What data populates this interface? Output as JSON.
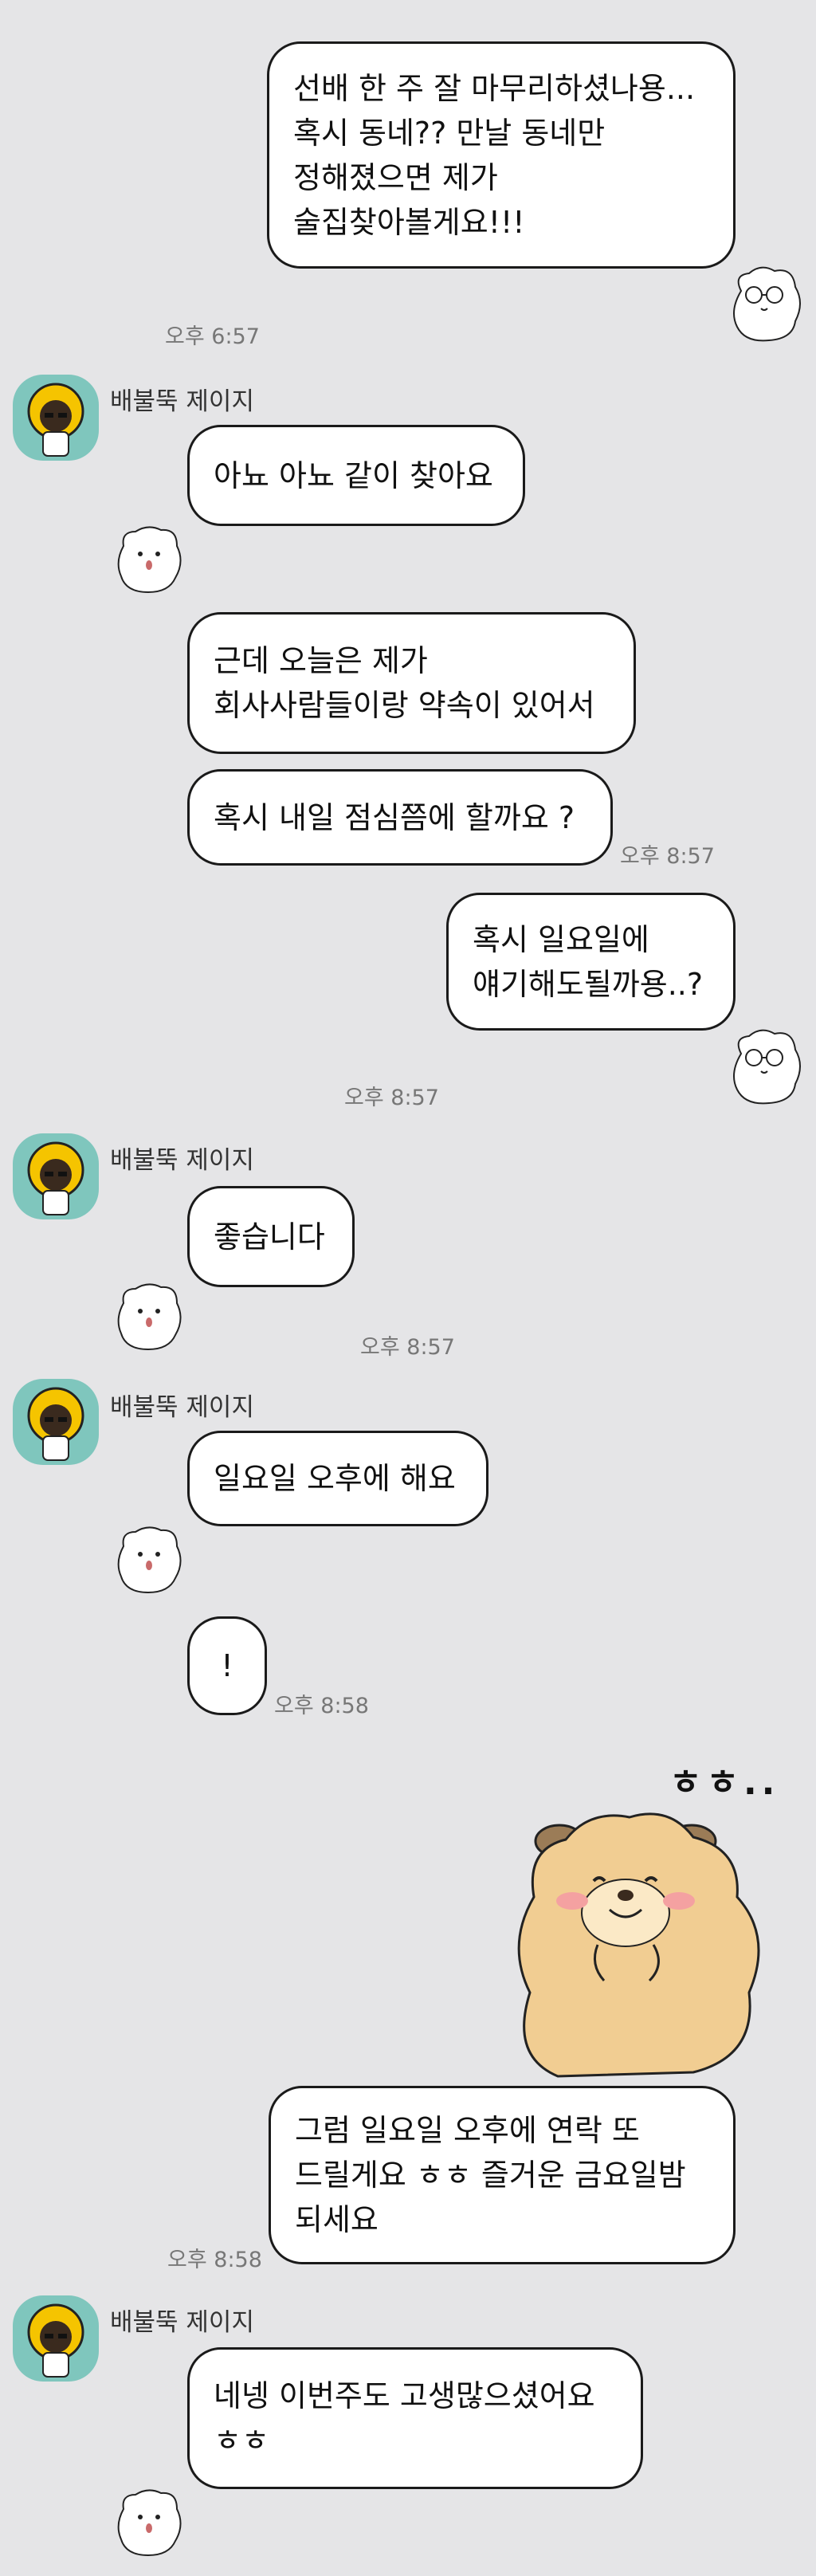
{
  "contact": {
    "name": "배불뚝 제이지",
    "avatar_icon": "yellow-haired-character-avatar",
    "avatar_bg": "#7fc6bd"
  },
  "messages": [
    {
      "id": "m1",
      "sender": "me",
      "text": "선배 한 주 잘 마무리하셨나용...\n혹시 동네?? 만날 동네만\n정해졌으면 제가\n술집찾아볼게요!!!",
      "time": "오후 6:57",
      "emoji": "hamster-glasses-emoji"
    },
    {
      "id": "m2",
      "sender": "them",
      "text": "아뇨 아뇨 같이 찾아요",
      "emoji": "hamster-emoji"
    },
    {
      "id": "m3",
      "sender": "them",
      "text": "근데 오늘은 제가\n회사사람들이랑 약속이 있어서"
    },
    {
      "id": "m4",
      "sender": "them",
      "text": "혹시 내일 점심쯤에 할까요 ?",
      "time": "오후 8:57"
    },
    {
      "id": "m5",
      "sender": "me",
      "text": "혹시 일요일에\n얘기해도될까용..?",
      "time": "오후 8:57",
      "emoji": "hamster-glasses-emoji"
    },
    {
      "id": "m6",
      "sender": "them",
      "text": "좋습니다",
      "time": "오후 8:57",
      "emoji": "hamster-emoji"
    },
    {
      "id": "m7",
      "sender": "them",
      "text": "일요일 오후에 해요",
      "emoji": "hamster-emoji"
    },
    {
      "id": "m8",
      "sender": "them",
      "text": "!",
      "time": "오후 8:58"
    },
    {
      "id": "m9",
      "sender": "me",
      "sticker": "alpaca-blushing-sticker",
      "sticker_text": "ㅎㅎ..",
      "sticker_color": "#f1cd92"
    },
    {
      "id": "m10",
      "sender": "me",
      "text": "그럼 일요일 오후에 연락 또\n드릴게요 ㅎㅎ 즐거운 금요일밤\n되세요",
      "time": "오후 8:58"
    },
    {
      "id": "m11",
      "sender": "them",
      "text": "네넹 이번주도 고생많으셨어요\nㅎㅎ",
      "emoji": "hamster-emoji"
    }
  ]
}
